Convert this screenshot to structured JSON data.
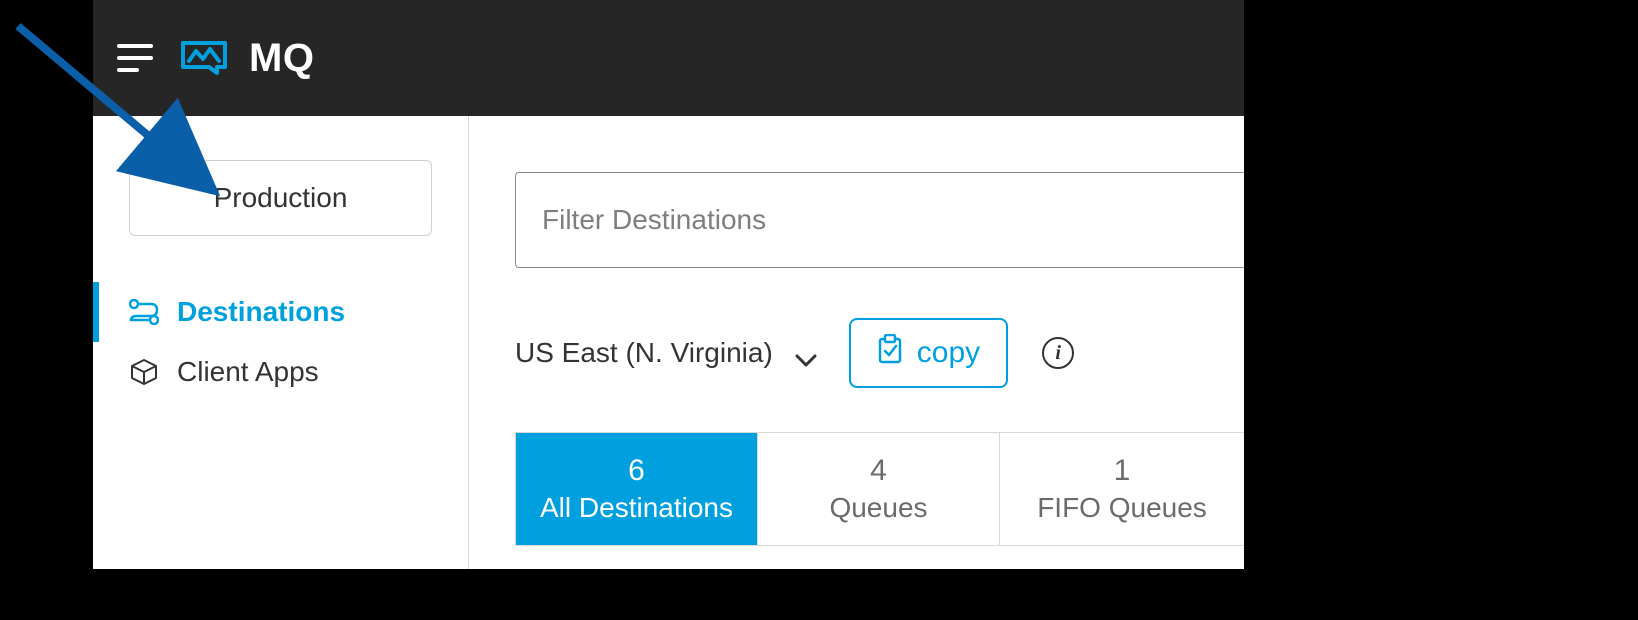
{
  "annotation": {
    "points_to": "environment-selector"
  },
  "header": {
    "app_title": "MQ"
  },
  "sidebar": {
    "environment": "Production",
    "items": [
      {
        "label": "Destinations",
        "icon": "route-icon",
        "active": true
      },
      {
        "label": "Client Apps",
        "icon": "box-icon",
        "active": false
      }
    ]
  },
  "main": {
    "filter_placeholder": "Filter Destinations",
    "region": {
      "selected": "US East (N. Virginia)"
    },
    "copy_label": "copy",
    "tabs": [
      {
        "count": "6",
        "label": "All Destinations",
        "active": true
      },
      {
        "count": "4",
        "label": "Queues",
        "active": false
      },
      {
        "count": "1",
        "label": "FIFO Queues",
        "active": false
      }
    ]
  }
}
